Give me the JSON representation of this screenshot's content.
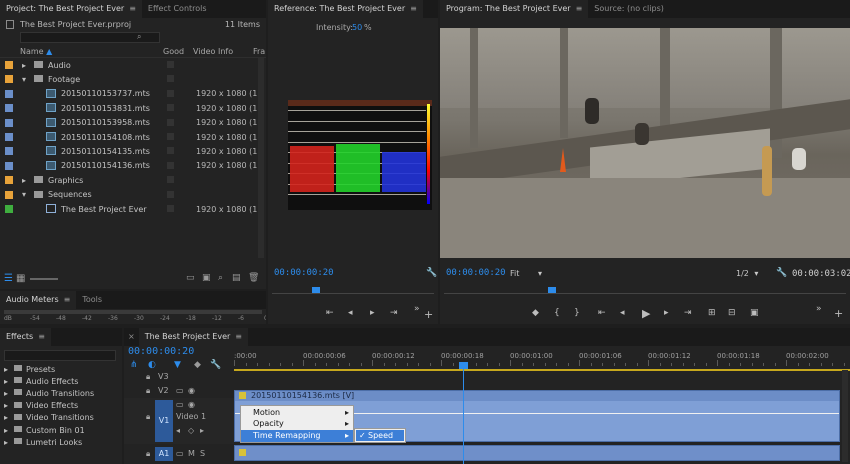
{
  "project_panel": {
    "tab_project": "Project: The Best Project Ever",
    "tab_effect_controls": "Effect Controls",
    "file_name": "The Best Project Ever.prproj",
    "item_count": "11 Items",
    "columns": {
      "name": "Name",
      "good": "Good",
      "video_info": "Video Info",
      "frame": "Fra"
    },
    "items": [
      {
        "name": "Audio",
        "type": "bin",
        "color": "#e8a33a",
        "info": "",
        "indent": 0
      },
      {
        "name": "Footage",
        "type": "bin-open",
        "color": "#e8a33a",
        "info": "",
        "indent": 0
      },
      {
        "name": "20150110153737.mts",
        "type": "clip",
        "color": "#6b8fc9",
        "info": "1920 x 1080 (1.",
        "indent": 1
      },
      {
        "name": "20150110153831.mts",
        "type": "clip",
        "color": "#6b8fc9",
        "info": "1920 x 1080 (1.",
        "indent": 1
      },
      {
        "name": "20150110153958.mts",
        "type": "clip",
        "color": "#6b8fc9",
        "info": "1920 x 1080 (1.",
        "indent": 1
      },
      {
        "name": "20150110154108.mts",
        "type": "clip",
        "color": "#6b8fc9",
        "info": "1920 x 1080 (1.",
        "indent": 1
      },
      {
        "name": "20150110154135.mts",
        "type": "clip",
        "color": "#6b8fc9",
        "info": "1920 x 1080 (1.",
        "indent": 1
      },
      {
        "name": "20150110154136.mts",
        "type": "clip",
        "color": "#6b8fc9",
        "info": "1920 x 1080 (1.",
        "indent": 1
      },
      {
        "name": "Graphics",
        "type": "bin",
        "color": "#e8a33a",
        "info": "",
        "indent": 0
      },
      {
        "name": "Sequences",
        "type": "bin-open",
        "color": "#e8a33a",
        "info": "",
        "indent": 0
      },
      {
        "name": "The Best Project Ever",
        "type": "sequence",
        "color": "#3fae3f",
        "info": "1920 x 1080 (1.",
        "indent": 1
      }
    ]
  },
  "reference_panel": {
    "tab": "Reference: The Best Project Ever",
    "intensity_label": "Intensity:",
    "intensity_value": "50",
    "intensity_unit": "%",
    "timecode": "00:00:00:20"
  },
  "program_panel": {
    "tab": "Program: The Best Project Ever",
    "tab_source": "Source: (no clips)",
    "timecode": "00:00:00:20",
    "fit": "Fit",
    "resolution": "1/2",
    "duration": "00:00:03:02"
  },
  "audio_meters": {
    "tab": "Audio Meters",
    "tab_tools": "Tools",
    "scale": [
      "dB",
      "-54",
      "-48",
      "-42",
      "-36",
      "-30",
      "-24",
      "-18",
      "-12",
      "-6",
      "0"
    ]
  },
  "effects_panel": {
    "tab": "Effects",
    "items": [
      "Presets",
      "Audio Effects",
      "Audio Transitions",
      "Video Effects",
      "Video Transitions",
      "Custom Bin 01",
      "Lumetri Looks"
    ]
  },
  "timeline": {
    "tab": "The Best Project Ever",
    "timecode": "00:00:00:20",
    "ruler_labels": [
      ":00:00",
      "00:00:00:06",
      "00:00:00:12",
      "00:00:00:18",
      "00:00:01:00",
      "00:00:01:06",
      "00:00:01:12",
      "00:00:01:18",
      "00:00:02:00",
      "00:00:0"
    ],
    "tracks": {
      "v3": "V3",
      "v2": "V2",
      "v1": "V1",
      "video1": "Video 1",
      "a1": "A1",
      "m": "M",
      "s": "S"
    },
    "clip_name": "20150110154136.mts [V]",
    "context_menu": {
      "motion": "Motion",
      "opacity": "Opacity",
      "time_remapping": "Time Remapping",
      "speed": "Speed"
    }
  }
}
